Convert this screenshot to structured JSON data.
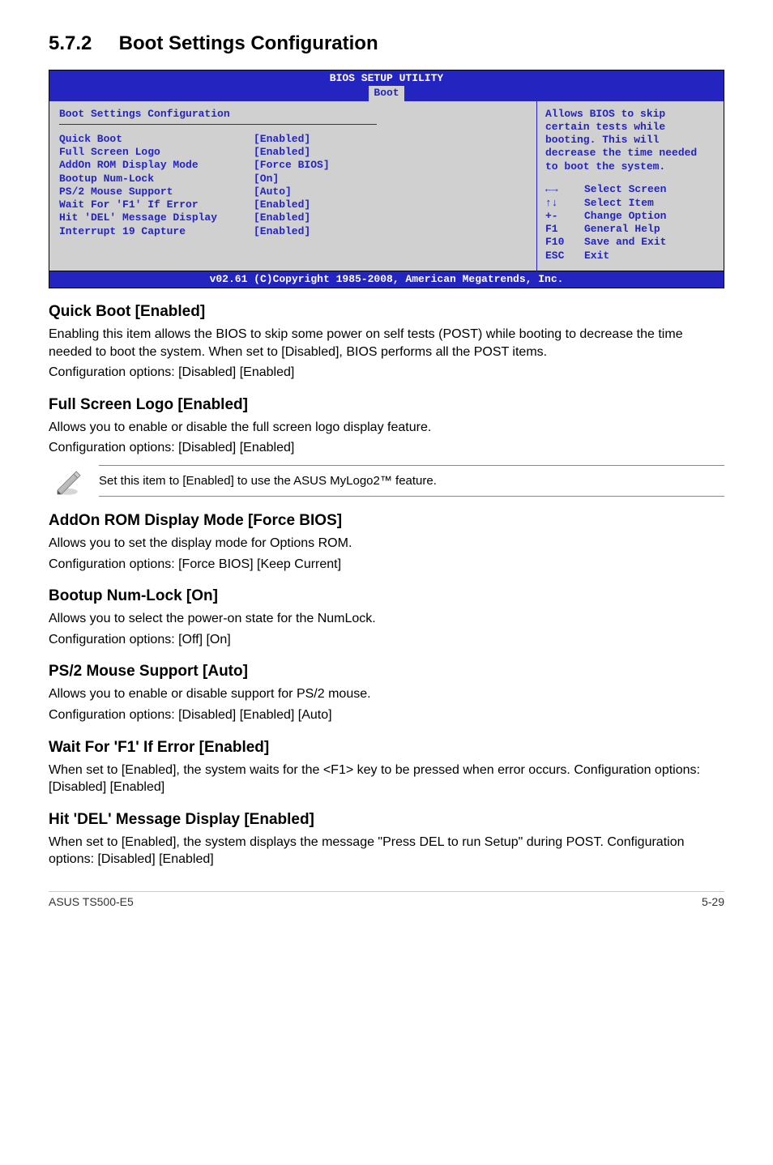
{
  "section": {
    "number": "5.7.2",
    "title": "Boot Settings Configuration"
  },
  "bios": {
    "utility_title": "BIOS SETUP UTILITY",
    "tab": "Boot",
    "panel_title": "Boot Settings Configuration",
    "rows": [
      {
        "label": "Quick Boot",
        "value": "[Enabled]"
      },
      {
        "label": "Full Screen Logo",
        "value": "[Enabled]"
      },
      {
        "label": "AddOn ROM Display Mode",
        "value": "[Force BIOS]"
      },
      {
        "label": "Bootup Num-Lock",
        "value": "[On]"
      },
      {
        "label": "PS/2 Mouse Support",
        "value": "[Auto]"
      },
      {
        "label": "Wait For 'F1' If Error",
        "value": "[Enabled]"
      },
      {
        "label": "Hit 'DEL' Message Display",
        "value": "[Enabled]"
      },
      {
        "label": "Interrupt 19 Capture",
        "value": "[Enabled]"
      }
    ],
    "help_text": "Allows BIOS to skip certain tests while booting. This will decrease the time needed to boot the system.",
    "nav": [
      {
        "key": "←→",
        "label": "Select Screen"
      },
      {
        "key": "↑↓",
        "label": "Select Item"
      },
      {
        "key": "+-",
        "label": "Change Option"
      },
      {
        "key": "F1",
        "label": "General Help"
      },
      {
        "key": "F10",
        "label": "Save and Exit"
      },
      {
        "key": "ESC",
        "label": "Exit"
      }
    ],
    "footer": "v02.61 (C)Copyright 1985-2008, American Megatrends, Inc."
  },
  "sections": {
    "quick_boot": {
      "title": "Quick Boot [Enabled]",
      "body": "Enabling this item allows the BIOS to skip some power on self tests (POST) while booting to decrease the time needed to boot the system. When set to [Disabled], BIOS performs all the POST items.",
      "config": "Configuration options: [Disabled] [Enabled]"
    },
    "full_screen_logo": {
      "title": "Full Screen Logo [Enabled]",
      "body": "Allows you to enable or disable the full screen logo display feature.",
      "config": "Configuration options: [Disabled] [Enabled]"
    },
    "note": "Set this item to [Enabled] to use the ASUS MyLogo2™ feature.",
    "addon_rom": {
      "title": "AddOn ROM Display Mode [Force BIOS]",
      "body": "Allows you to set the display mode for Options ROM.",
      "config": "Configuration options: [Force BIOS] [Keep Current]"
    },
    "bootup_numlock": {
      "title": "Bootup Num-Lock [On]",
      "body": "Allows you to select the power-on state for the NumLock.",
      "config": "Configuration options: [Off] [On]"
    },
    "ps2_mouse": {
      "title": "PS/2 Mouse Support [Auto]",
      "body": "Allows you to enable or disable support for PS/2 mouse.",
      "config": "Configuration options: [Disabled] [Enabled] [Auto]"
    },
    "wait_f1": {
      "title": "Wait For 'F1' If Error [Enabled]",
      "body": "When set to [Enabled], the system waits for the <F1> key to be pressed when error occurs. Configuration options: [Disabled] [Enabled]"
    },
    "hit_del": {
      "title": "Hit 'DEL' Message Display [Enabled]",
      "body": "When set to [Enabled], the system displays the message \"Press DEL to run Setup\" during POST. Configuration options: [Disabled] [Enabled]"
    }
  },
  "footer": {
    "left": "ASUS TS500-E5",
    "right": "5-29"
  }
}
